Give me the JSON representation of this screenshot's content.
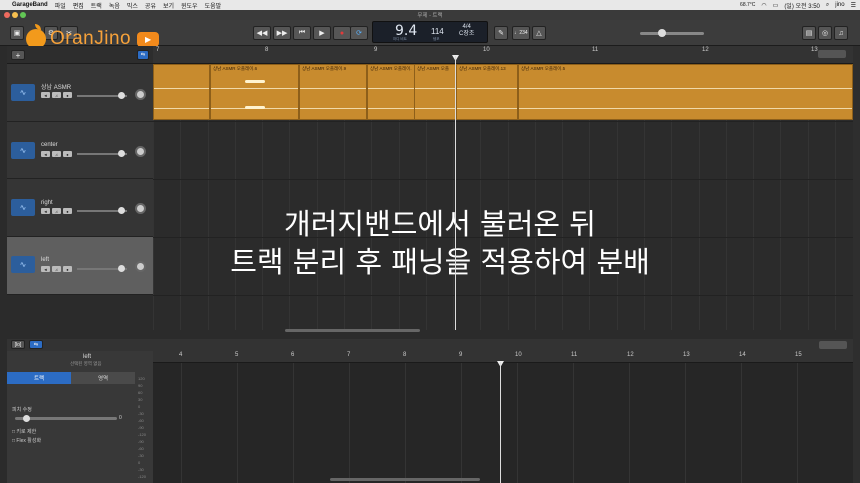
{
  "menubar": {
    "app": "GarageBand",
    "items": [
      "파일",
      "편집",
      "트랙",
      "녹음",
      "믹스",
      "공유",
      "보기",
      "윈도우",
      "도움말"
    ],
    "weather": "68.7°C",
    "clock": "(일) 오전 3:50",
    "user": "jino"
  },
  "window": {
    "title": "무제 - 트랙"
  },
  "lcd": {
    "bar": "9.4",
    "tempo": "114",
    "signature": "4/4",
    "key": "C장조"
  },
  "toolbar": {
    "count_in": "♩234"
  },
  "logo": {
    "text": "OranJino"
  },
  "ruler": {
    "numbers": [
      "7",
      "8",
      "9",
      "10",
      "11",
      "12",
      "13"
    ]
  },
  "tracks": [
    {
      "name": "상남 ASMR"
    },
    {
      "name": "center"
    },
    {
      "name": "right"
    },
    {
      "name": "left"
    }
  ],
  "regions": [
    {
      "name": "상남 ASMR 오플레이.6"
    },
    {
      "name": "상남 ASMR 오플레이.9"
    },
    {
      "name": "상남 ASMR 오플레이."
    },
    {
      "name": "상남 ASMR 오플레이"
    },
    {
      "name": "상남 ASMR 오플"
    },
    {
      "name": "상남 ASMR 오플레이.13"
    },
    {
      "name": "상남 ASMR 오플레이.5"
    }
  ],
  "caption": {
    "line1": "개러지밴드에서 불러온 뒤",
    "line2": "트랙 분리 후 패닝을 적용하여 분배"
  },
  "editor": {
    "track_name": "left",
    "subtitle": "선택된 영역 없음",
    "tab_track": "트랙",
    "tab_region": "영역",
    "pitch_label": "피치 수정",
    "pitch_value": "0",
    "key_limit": "키로 제한",
    "flex": "Flex 활성화",
    "ruler_numbers": [
      "4",
      "5",
      "6",
      "7",
      "8",
      "9",
      "10",
      "11",
      "12",
      "13",
      "14",
      "15"
    ],
    "y_labels": [
      "120",
      "90",
      "60",
      "30",
      "0",
      "-30",
      "-60",
      "-90",
      "-120",
      "-90",
      "-60",
      "-30",
      "0",
      "-30",
      "-120"
    ]
  },
  "colors": {
    "region": "#c88b2e",
    "accent": "#f7a23a",
    "track_icon": "#2c5e9c"
  }
}
